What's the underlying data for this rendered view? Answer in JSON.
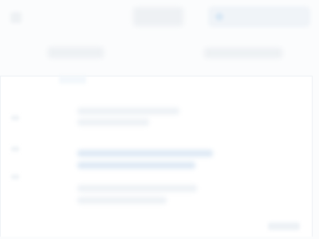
{
  "top": {
    "left_icon": "menu-icon",
    "center_label": "",
    "search_placeholder": ""
  },
  "secondary": {
    "left_label": "",
    "right_label": ""
  },
  "panel": {
    "rows": [
      {
        "label": ""
      },
      {
        "label": ""
      },
      {
        "label": ""
      },
      {
        "label": ""
      },
      {
        "label": ""
      },
      {
        "label": ""
      }
    ]
  },
  "footer": {
    "label": ""
  },
  "colors": {
    "background": "#fbfcfd",
    "panel": "#ffffff",
    "accent": "#dfeaf5"
  }
}
